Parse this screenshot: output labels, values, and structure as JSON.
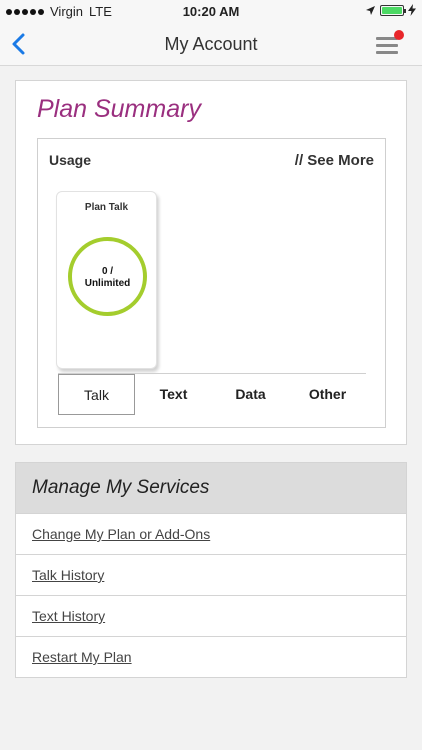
{
  "status_bar": {
    "carrier": "Virgin",
    "network": "LTE",
    "time": "10:20 AM"
  },
  "nav": {
    "title": "My Account",
    "back_icon": "chevron-left-icon",
    "menu_icon": "hamburger-menu-icon",
    "accent_color": "#1a7ae6",
    "badge_color": "#e8262a"
  },
  "plan_summary": {
    "title": "Plan Summary",
    "title_color": "#9a2f7f",
    "usage_label": "Usage",
    "see_more": "// See More",
    "tile": {
      "title": "Plan Talk",
      "used": "0 /",
      "limit": "Unlimited",
      "ring_color": "#a4cd2d"
    },
    "tabs": [
      {
        "label": "Talk",
        "active": true
      },
      {
        "label": "Text",
        "active": false
      },
      {
        "label": "Data",
        "active": false
      },
      {
        "label": "Other",
        "active": false
      }
    ]
  },
  "services": {
    "title": "Manage My Services",
    "items": [
      "Change My Plan or Add-Ons",
      "Talk History",
      "Text History",
      "Restart My Plan"
    ]
  }
}
